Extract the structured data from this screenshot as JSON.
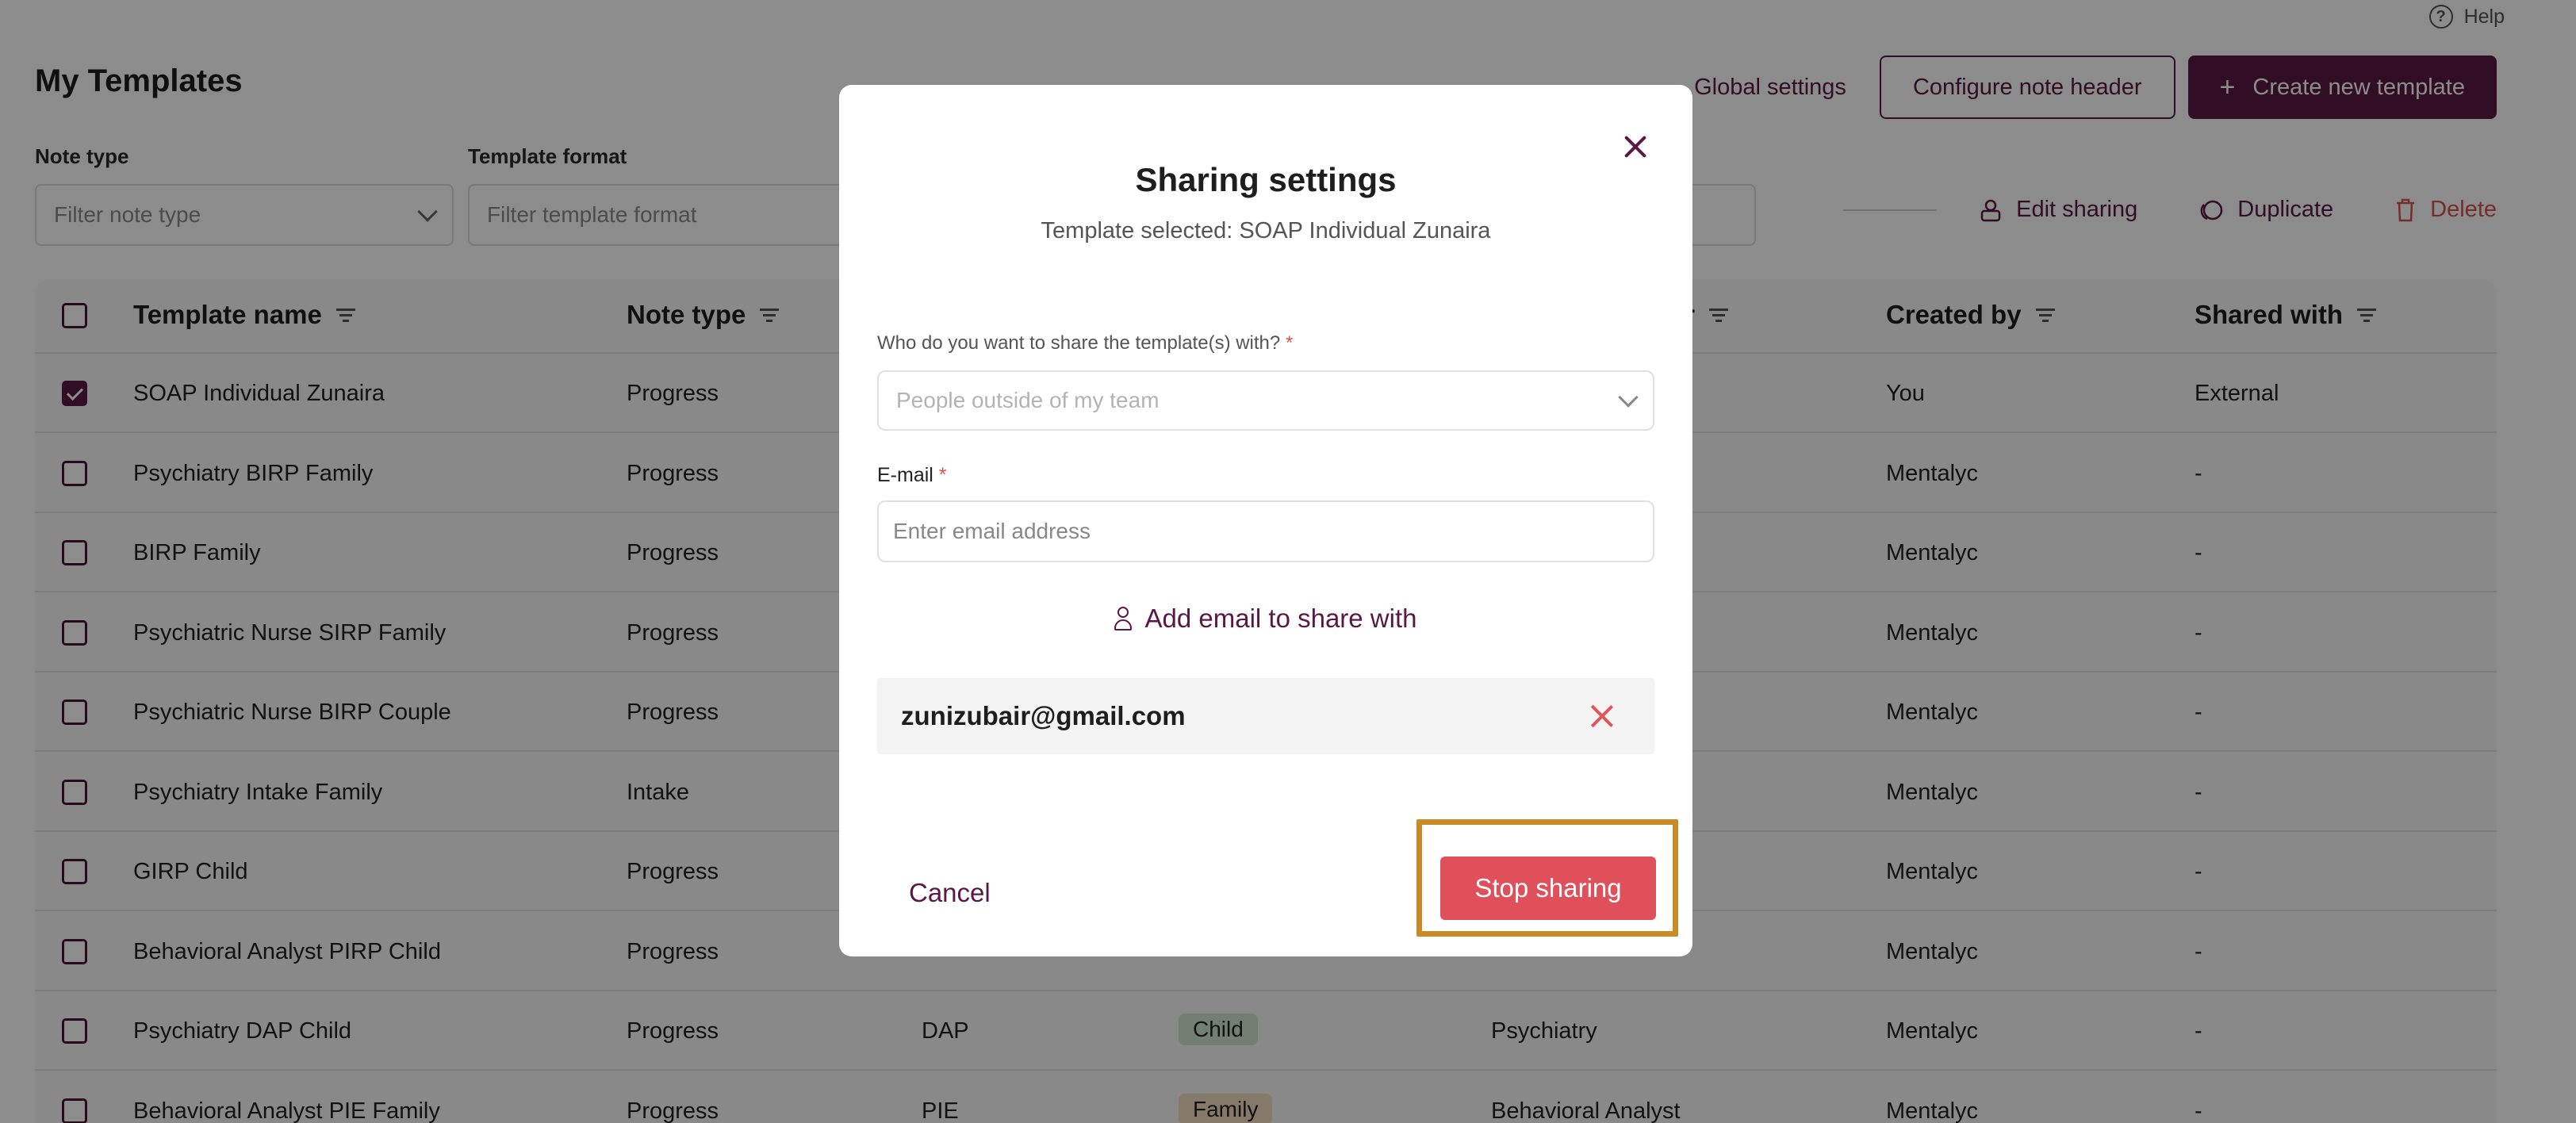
{
  "help_label": "Help",
  "page_title": "My Templates",
  "header": {
    "global_settings": "Global settings",
    "configure_note_header": "Configure note header",
    "create_new_template": "Create new template",
    "create_icon": "plus-icon"
  },
  "filters": {
    "note_type_label": "Note type",
    "note_type_placeholder": "Filter note type",
    "template_format_label": "Template format",
    "template_format_placeholder": "Filter template format"
  },
  "bulk_actions": {
    "edit_sharing": "Edit sharing",
    "duplicate": "Duplicate",
    "delete": "Delete"
  },
  "table": {
    "columns": {
      "template_name": "Template name",
      "note_type": "Note type",
      "author_partial": "or",
      "created_by": "Created by",
      "shared_with": "Shared with"
    },
    "rows": [
      {
        "checked": true,
        "name": "SOAP Individual Zunaira",
        "note_type": "Progress",
        "format": "",
        "tag": "",
        "author": "",
        "created_by": "You",
        "shared_with": "External"
      },
      {
        "checked": false,
        "name": "Psychiatry BIRP Family",
        "note_type": "Progress",
        "format": "",
        "tag": "",
        "author": "",
        "created_by": "Mentalyc",
        "shared_with": "-"
      },
      {
        "checked": false,
        "name": "BIRP Family",
        "note_type": "Progress",
        "format": "",
        "tag": "",
        "author": "",
        "created_by": "Mentalyc",
        "shared_with": "-"
      },
      {
        "checked": false,
        "name": "Psychiatric Nurse SIRP Family",
        "note_type": "Progress",
        "format": "",
        "tag": "",
        "author": "",
        "created_by": "Mentalyc",
        "shared_with": "-"
      },
      {
        "checked": false,
        "name": "Psychiatric Nurse BIRP Couple",
        "note_type": "Progress",
        "format": "",
        "tag": "",
        "author": "",
        "created_by": "Mentalyc",
        "shared_with": "-"
      },
      {
        "checked": false,
        "name": "Psychiatry Intake Family",
        "note_type": "Intake",
        "format": "",
        "tag": "",
        "author": "",
        "created_by": "Mentalyc",
        "shared_with": "-"
      },
      {
        "checked": false,
        "name": "GIRP Child",
        "note_type": "Progress",
        "format": "",
        "tag": "",
        "author": "",
        "created_by": "Mentalyc",
        "shared_with": "-"
      },
      {
        "checked": false,
        "name": "Behavioral Analyst PIRP Child",
        "note_type": "Progress",
        "format": "",
        "tag": "",
        "author": "",
        "created_by": "Mentalyc",
        "shared_with": "-"
      },
      {
        "checked": false,
        "name": "Psychiatry DAP Child",
        "note_type": "Progress",
        "format": "DAP",
        "tag": "Child",
        "author": "Psychiatry",
        "created_by": "Mentalyc",
        "shared_with": "-"
      },
      {
        "checked": false,
        "name": "Behavioral Analyst PIE Family",
        "note_type": "Progress",
        "format": "PIE",
        "tag": "Family",
        "author": "Behavioral Analyst",
        "created_by": "Mentalyc",
        "shared_with": "-"
      }
    ]
  },
  "modal": {
    "title": "Sharing settings",
    "subtitle": "Template selected: SOAP Individual Zunaira",
    "share_with_label": "Who do you want to share the template(s) with?",
    "share_with_value": "People outside of my team",
    "required_mark": "*",
    "email_label": "E-mail",
    "email_placeholder": "Enter email address",
    "add_email": "Add email to share with",
    "shared_email": "zunizubair@gmail.com",
    "cancel": "Cancel",
    "stop_sharing": "Stop sharing"
  },
  "colors": {
    "brand": "#5a1846",
    "danger": "#e0505a",
    "highlight": "#c98a28",
    "tag_child": "#cfe8cf",
    "tag_family": "#f3dcc2"
  }
}
